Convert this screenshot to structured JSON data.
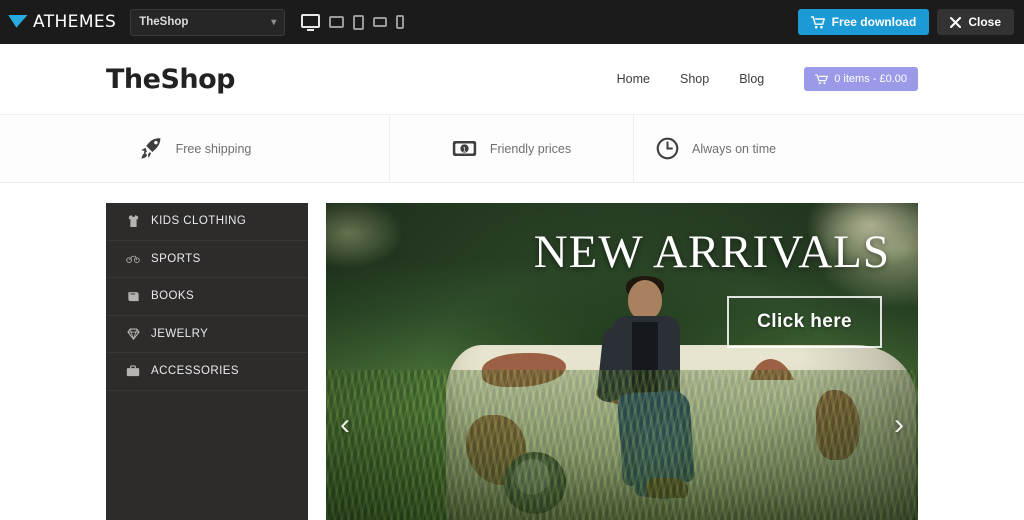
{
  "admin_bar": {
    "brand": "ATHEMES",
    "brand_icon": "athemes-triangle-logo",
    "site_select": {
      "value": "TheShop",
      "chevron": "chevron-down-icon"
    },
    "devices": [
      {
        "name": "desktop",
        "icon": "desktop-icon",
        "active": true
      },
      {
        "name": "laptop",
        "icon": "laptop-icon",
        "active": false
      },
      {
        "name": "tablet-portrait",
        "icon": "tablet-portrait-icon",
        "active": false
      },
      {
        "name": "tablet-landscape",
        "icon": "tablet-landscape-icon",
        "active": false
      },
      {
        "name": "mobile",
        "icon": "mobile-icon",
        "active": false
      }
    ],
    "download_button": {
      "label": "Free download",
      "icon": "cart-icon",
      "color": "#1c9ad6"
    },
    "close_button": {
      "label": "Close",
      "icon": "close-x-icon",
      "color": "#333333"
    }
  },
  "site_header": {
    "logo": "TheShop",
    "nav": [
      {
        "label": "Home"
      },
      {
        "label": "Shop"
      },
      {
        "label": "Blog"
      }
    ],
    "cart": {
      "label": "0 items - £0.00",
      "icon": "shopping-cart-icon",
      "color": "#9a9ae8"
    }
  },
  "features": [
    {
      "icon": "rocket-icon",
      "label": "Free shipping"
    },
    {
      "icon": "money-bill-icon",
      "label": "Friendly prices"
    },
    {
      "icon": "clock-icon",
      "label": "Always on time"
    }
  ],
  "sidebar": {
    "categories": [
      {
        "icon": "tshirt-icon",
        "label": "KIDS CLOTHING"
      },
      {
        "icon": "bicycle-icon",
        "label": "SPORTS"
      },
      {
        "icon": "book-icon",
        "label": "BOOKS"
      },
      {
        "icon": "diamond-icon",
        "label": "JEWELRY"
      },
      {
        "icon": "briefcase-icon",
        "label": "ACCESSORIES"
      }
    ]
  },
  "hero": {
    "title": "NEW ARRIVALS",
    "cta": "Click here",
    "prev_arrow": "‹",
    "next_arrow": "›",
    "image_description": "man sitting on rusty abandoned car in tall grass"
  }
}
